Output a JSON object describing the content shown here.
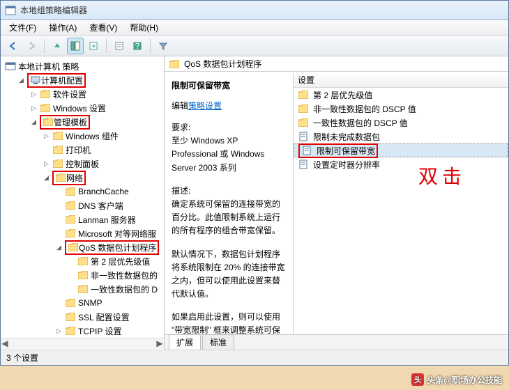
{
  "window": {
    "title": "本地组策略编辑器"
  },
  "menu": {
    "file": "文件(F)",
    "action": "操作(A)",
    "view": "查看(V)",
    "help": "帮助(H)"
  },
  "tree": {
    "root": "本地计算机 策略",
    "computer_config": "计算机配置",
    "software_settings": "软件设置",
    "windows_settings": "Windows 设置",
    "admin_templates": "管理模板",
    "windows_components": "Windows 组件",
    "printers": "打印机",
    "control_panel": "控制面板",
    "network": "网络",
    "branchcache": "BranchCache",
    "dns_client": "DNS 客户端",
    "lanman_server": "Lanman 服务器",
    "microsoft_p2p": "Microsoft 对等网络服",
    "qos": "QoS 数据包计划程序",
    "layer2_priority": "第 2 层优先级值",
    "nonconformant_dscp": "非一致性数据包的",
    "conformant_dscp": "一致性数据包的 D",
    "snmp": "SNMP",
    "ssl_config": "SSL 配置设置",
    "tcpip_settings": "TCPIP 设置"
  },
  "addressbar": "QoS 数据包计划程序",
  "detail": {
    "heading": "限制可保留带宽",
    "edit_label": "编辑",
    "edit_link": "策略设置",
    "req_label": "要求:",
    "req_text": "至少 Windows XP Professional 或 Windows Server 2003 系列",
    "desc_label": "描述:",
    "desc_text": "确定系统可保留的连接带宽的百分比。此值限制系统上运行的所有程序的组合带宽保留。",
    "default_text": "默认情况下，数据包计划程序将系统限制在 20% 的连接带宽之内，但可以使用此设置来替代默认值。",
    "enable_text": "如果启用此设置，则可以使用 \"带宽限制\" 框来调整系统可保留的"
  },
  "list": {
    "header": "设置",
    "items": [
      "第 2 层优先级值",
      "非一致性数据包的 DSCP 值",
      "一致性数据包的 DSCP 值",
      "限制未完成数据包",
      "限制可保留带宽",
      "设置定时器分辨率"
    ]
  },
  "righttabs": {
    "extended": "扩展",
    "standard": "标准"
  },
  "status": "3 个设置",
  "annotation": "双击",
  "watermark": "头条@职场办公技能"
}
